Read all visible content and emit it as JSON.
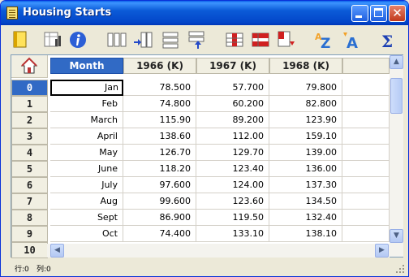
{
  "window": {
    "title": "Housing Starts",
    "minimize_icon": "minimize-icon",
    "maximize_icon": "maximize-icon",
    "close_icon": "close-icon"
  },
  "toolbar": {
    "buttons": [
      {
        "name": "new-note-icon"
      },
      {
        "name": "chart-icon"
      },
      {
        "name": "info-icon"
      },
      {
        "name": "insert-column-icon"
      },
      {
        "name": "insert-column-left-icon"
      },
      {
        "name": "insert-row-icon"
      },
      {
        "name": "insert-row-up-icon"
      },
      {
        "name": "delete-column-icon"
      },
      {
        "name": "delete-rows-icon"
      },
      {
        "name": "delete-cells-icon"
      },
      {
        "name": "sort-az-icon"
      },
      {
        "name": "sort-descending-icon"
      },
      {
        "name": "sum-icon"
      }
    ]
  },
  "grid": {
    "home_icon": "home-icon",
    "columns": [
      "Month",
      "1966 (K)",
      "1967 (K)",
      "1968 (K)"
    ],
    "row_numbers": [
      "0",
      "1",
      "2",
      "3",
      "4",
      "5",
      "6",
      "7",
      "8",
      "9",
      "10"
    ],
    "rows": [
      [
        "Jan",
        "78.500",
        "57.700",
        "79.800"
      ],
      [
        "Feb",
        "74.800",
        "60.200",
        "82.800"
      ],
      [
        "March",
        "115.90",
        "89.200",
        "123.90"
      ],
      [
        "April",
        "138.60",
        "112.00",
        "159.10"
      ],
      [
        "May",
        "126.70",
        "129.70",
        "139.00"
      ],
      [
        "June",
        "118.20",
        "123.40",
        "136.00"
      ],
      [
        "July",
        "97.600",
        "124.00",
        "137.30"
      ],
      [
        "Aug",
        "99.600",
        "123.60",
        "134.50"
      ],
      [
        "Sept",
        "86.900",
        "119.50",
        "132.40"
      ],
      [
        "Oct",
        "74.400",
        "133.10",
        "138.10"
      ]
    ]
  },
  "status": {
    "row_label": "行:0",
    "col_label": "列:0"
  },
  "colors": {
    "title_bar": "#0a5fe8",
    "selected_header": "#316ac5",
    "window_bg": "#ece9d8"
  }
}
